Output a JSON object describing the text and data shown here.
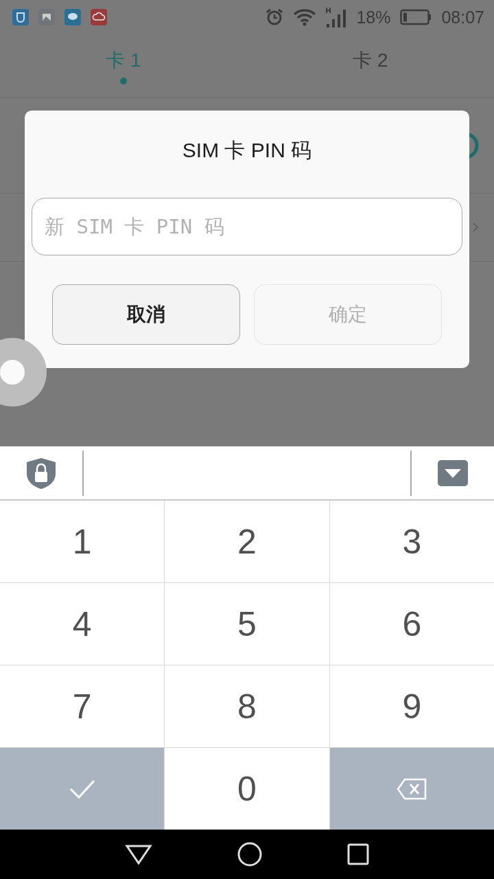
{
  "status_bar": {
    "battery": "18%",
    "time": "08:07"
  },
  "tabs": [
    {
      "label": "卡 1",
      "selected": true
    },
    {
      "label": "卡 2",
      "selected": false
    }
  ],
  "dialog": {
    "title": "SIM 卡 PIN 码",
    "input": {
      "placeholder": "新 SIM 卡 PIN 码"
    },
    "buttons": [
      {
        "label": "取消",
        "disabled": false
      },
      {
        "label": "确定",
        "disabled": true
      }
    ]
  },
  "keypad": {
    "keys": [
      {
        "kind": "digit",
        "label": "1"
      },
      {
        "kind": "digit",
        "label": "2"
      },
      {
        "kind": "digit",
        "label": "3"
      },
      {
        "kind": "digit",
        "label": "4"
      },
      {
        "kind": "digit",
        "label": "5"
      },
      {
        "kind": "digit",
        "label": "6"
      },
      {
        "kind": "digit",
        "label": "7"
      },
      {
        "kind": "digit",
        "label": "8"
      },
      {
        "kind": "digit",
        "label": "9"
      },
      {
        "kind": "confirm"
      },
      {
        "kind": "digit",
        "label": "0"
      },
      {
        "kind": "backspace"
      }
    ]
  }
}
